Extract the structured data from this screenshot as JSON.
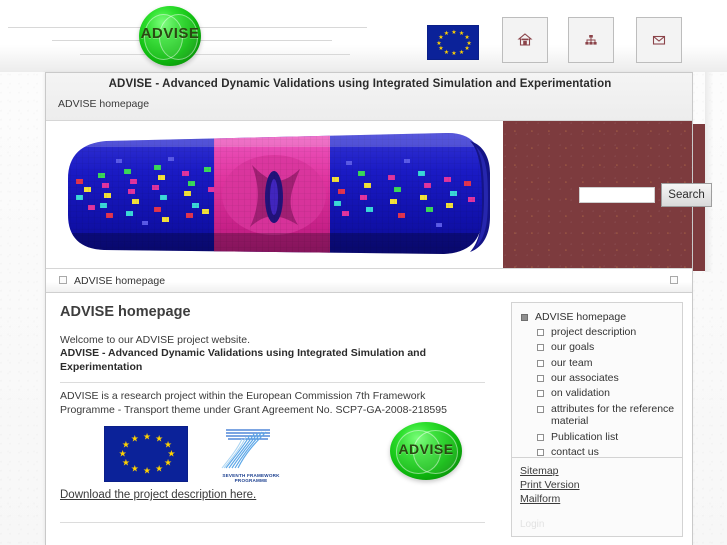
{
  "header": {
    "logo_text": "ADVISE",
    "eu_flag_name": "european-union-flag",
    "buttons": [
      {
        "name": "home-button",
        "icon": "home-icon"
      },
      {
        "name": "sitemap-button",
        "icon": "sitemap-icon"
      },
      {
        "name": "mail-button",
        "icon": "envelope-icon"
      }
    ]
  },
  "window": {
    "site_title": "ADVISE - Advanced Dynamic Validations using Integrated Simulation and Experimentation",
    "subline": "ADVISE homepage"
  },
  "hero": {
    "image_alt": "finite-element-tube-crush-simulation"
  },
  "search": {
    "value": "",
    "placeholder": "",
    "button_label": "Search"
  },
  "breadcrumb": {
    "label": "ADVISE homepage"
  },
  "main": {
    "page_title": "ADVISE homepage",
    "intro_line": "Welcome to our ADVISE project website.",
    "intro_strong": "ADVISE - Advanced Dynamic Validations using Integrated Simulation and Experimentation",
    "grant_text": "ADVISE is a research project within the European Commission 7th Framework Programme - Transport theme under Grant Agreement No.  SCP7-GA-2008-218595",
    "download_link": "Download the project description here.",
    "logos": {
      "eu_flag_name": "european-union-flag",
      "fp7_caption": "SEVENTH FRAMEWORK PROGRAMME",
      "advise_logo_text": "ADVISE"
    }
  },
  "sidebar": {
    "nav_items": [
      {
        "label": "ADVISE homepage",
        "level": 0,
        "name": "sidebar-item-advise-homepage"
      },
      {
        "label": "project description",
        "level": 1,
        "name": "sidebar-item-project-description"
      },
      {
        "label": "our goals",
        "level": 1,
        "name": "sidebar-item-our-goals"
      },
      {
        "label": "our team",
        "level": 1,
        "name": "sidebar-item-our-team"
      },
      {
        "label": "our associates",
        "level": 1,
        "name": "sidebar-item-our-associates"
      },
      {
        "label": "on validation",
        "level": 1,
        "name": "sidebar-item-on-validation"
      },
      {
        "label": "attributes for the reference material",
        "level": 1,
        "name": "sidebar-item-attributes-reference-material"
      },
      {
        "label": "Publication list",
        "level": 1,
        "name": "sidebar-item-publication-list"
      },
      {
        "label": "contact us",
        "level": 1,
        "name": "sidebar-item-contact-us"
      }
    ],
    "links": [
      {
        "label": "Sitemap",
        "name": "sitemap-link"
      },
      {
        "label": "Print Version",
        "name": "print-version-link"
      },
      {
        "label": "Mailform",
        "name": "mailform-link"
      }
    ],
    "login_label": "Login"
  },
  "colors": {
    "maroon": "#7d3b3e",
    "eu_blue": "#0b2299",
    "eu_star": "#ffd100",
    "logo_green": "#1fc81f",
    "fp7_blue": "#1b3f8f",
    "icon_maroon": "#8b4349"
  }
}
